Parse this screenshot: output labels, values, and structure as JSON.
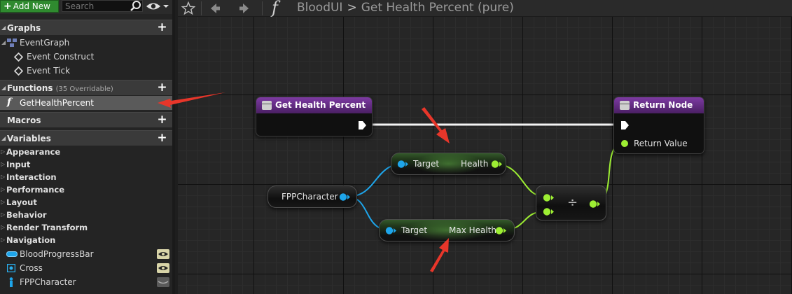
{
  "left_panel": {
    "add_new_label": "Add New",
    "search_placeholder": "Search",
    "sections": {
      "graphs": "Graphs",
      "functions": "Functions",
      "functions_sub": "(35 Overridable)",
      "macros": "Macros",
      "variables": "Variables"
    },
    "graph_items": [
      "EventGraph",
      "Event Construct",
      "Event Tick"
    ],
    "function_items": [
      "GetHealthPercent"
    ],
    "variable_categories": [
      "Appearance",
      "Input",
      "Interaction",
      "Performance",
      "Layout",
      "Behavior",
      "Render Transform",
      "Navigation"
    ],
    "variables": [
      "BloodProgressBar",
      "Cross",
      "FPPCharacter"
    ]
  },
  "toolbar": {
    "breadcrumb_root": "BloodUI",
    "breadcrumb_current": "Get Health Percent (pure)"
  },
  "graph": {
    "entry_node_title": "Get Health Percent",
    "return_node_title": "Return Node",
    "return_value_label": "Return Value",
    "fpp_character_label": "FPPCharacter",
    "health_target_label": "Target",
    "health_output_label": "Health",
    "maxhealth_target_label": "Target",
    "maxhealth_output_label": "Max Health",
    "divide_symbol": "÷"
  },
  "colors": {
    "exec_pin": "#ffffff",
    "object_pin": "#1ea5ea",
    "float_pin": "#9dee33",
    "function_header": "#6e2f91",
    "annotation_arrow": "#e8362a",
    "add_new_green": "#2f8a2f"
  }
}
